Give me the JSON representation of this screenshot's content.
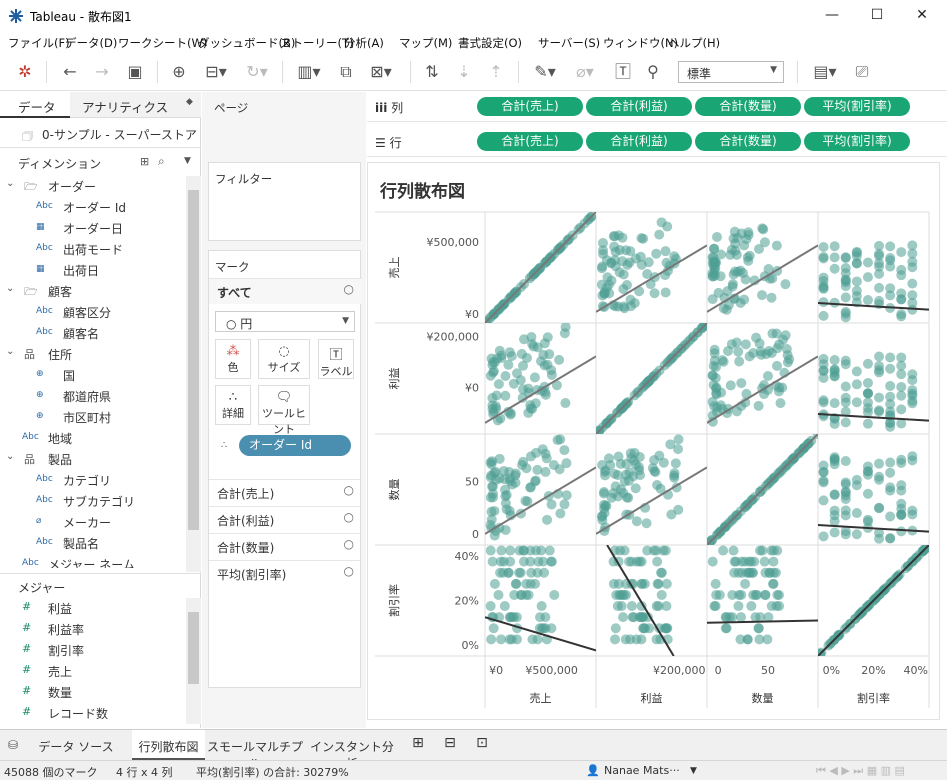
{
  "window": {
    "title": "Tableau - 散布図1",
    "minimize": "—",
    "maximize": "☐",
    "close": "✕"
  },
  "menu": [
    "ファイル(F)",
    "データ(D)",
    "ワークシート(W)",
    "ダッシュボード(B)",
    "ストーリー(T)",
    "分析(A)",
    "マップ(M)",
    "書式設定(O)",
    "サーバー(S)",
    "ウィンドウ(N)",
    "ヘルプ(H)"
  ],
  "toolbar": {
    "fit_select": "標準"
  },
  "left_pane": {
    "tab_data": "データ",
    "tab_analytics": "アナリティクス",
    "datasource": "0-サンプル - スーパーストア",
    "dimensions_header": "ディメンション",
    "dimensions": [
      {
        "kind": "group",
        "label": "オーダー",
        "icon": "folder-icon"
      },
      {
        "kind": "leaf",
        "label": "オーダー Id",
        "icon": "Abc"
      },
      {
        "kind": "leaf",
        "label": "オーダー日",
        "icon": "date-icon"
      },
      {
        "kind": "leaf",
        "label": "出荷モード",
        "icon": "Abc"
      },
      {
        "kind": "leaf",
        "label": "出荷日",
        "icon": "date-icon"
      },
      {
        "kind": "group",
        "label": "顧客",
        "icon": "folder-icon"
      },
      {
        "kind": "leaf",
        "label": "顧客区分",
        "icon": "Abc"
      },
      {
        "kind": "leaf",
        "label": "顧客名",
        "icon": "Abc"
      },
      {
        "kind": "group",
        "label": "住所",
        "icon": "hierarchy-icon"
      },
      {
        "kind": "leaf",
        "label": "国",
        "icon": "globe-icon"
      },
      {
        "kind": "leaf",
        "label": "都道府県",
        "icon": "globe-icon"
      },
      {
        "kind": "leaf",
        "label": "市区町村",
        "icon": "globe-icon"
      },
      {
        "kind": "plain",
        "label": "地域",
        "icon": "Abc"
      },
      {
        "kind": "group",
        "label": "製品",
        "icon": "hierarchy-icon"
      },
      {
        "kind": "leaf",
        "label": "カテゴリ",
        "icon": "Abc"
      },
      {
        "kind": "leaf",
        "label": "サブカテゴリ",
        "icon": "Abc"
      },
      {
        "kind": "leaf",
        "label": "メーカー",
        "icon": "paperclip-icon"
      },
      {
        "kind": "leaf",
        "label": "製品名",
        "icon": "Abc"
      },
      {
        "kind": "plain",
        "label": "メジャー ネーム",
        "icon": "Abc"
      }
    ],
    "measures_header": "メジャー",
    "measures": [
      "利益",
      "利益率",
      "割引率",
      "売上",
      "数量",
      "レコード数"
    ]
  },
  "cards": {
    "pages": "ページ",
    "filters": "フィルター",
    "marks": "マーク",
    "marks_all": "すべて",
    "mark_type": "○ 円",
    "color": "色",
    "size": "サイズ",
    "label": "ラベル",
    "detail": "詳細",
    "tooltip": "ツールヒント",
    "detail_pill": "オーダー Id",
    "measure_rows": [
      "合計(売上)",
      "合計(利益)",
      "合計(数量)",
      "平均(割引率)"
    ]
  },
  "shelves": {
    "columns_label": "列",
    "rows_label": "行",
    "columns": [
      "合計(売上)",
      "合計(利益)",
      "合計(数量)",
      "平均(割引率)"
    ],
    "rows": [
      "合計(売上)",
      "合計(利益)",
      "合計(数量)",
      "平均(割引率)"
    ]
  },
  "colors": {
    "accent": "#19a674",
    "mark": "#4e9e94",
    "trend": "#777777",
    "trend_dark": "#333333",
    "pill_blue": "#4a8fb0"
  },
  "chart_data": {
    "type": "scatter",
    "title": "行列散布図",
    "variables": [
      "売上",
      "利益",
      "数量",
      "割引率"
    ],
    "row_labels": [
      "売上",
      "利益",
      "数量",
      "割引率"
    ],
    "column_labels": [
      "売上",
      "利益",
      "数量",
      "割引率"
    ],
    "row_ticks": [
      [
        "¥500,000",
        "¥0"
      ],
      [
        "¥200,000",
        "¥0"
      ],
      [
        "50",
        "0"
      ],
      [
        "40%",
        "20%",
        "0%"
      ]
    ],
    "column_ticks": [
      [
        "¥0",
        "¥500,000"
      ],
      [
        "¥200,000"
      ],
      [
        "0",
        "50"
      ],
      [
        "0%",
        "20%",
        "40%"
      ]
    ],
    "grid": false,
    "trend_lines": true
  },
  "sheet_tabs": {
    "datasource": "データ ソース",
    "tabs": [
      "行列散布図",
      "スモールマルチプル",
      "インスタント分析"
    ]
  },
  "status": {
    "marks": "45088 個のマーク",
    "grid": "4 行 x 4 列",
    "sum": "平均(割引率) の合計: 30279%",
    "user": "Nanae Mats···"
  }
}
